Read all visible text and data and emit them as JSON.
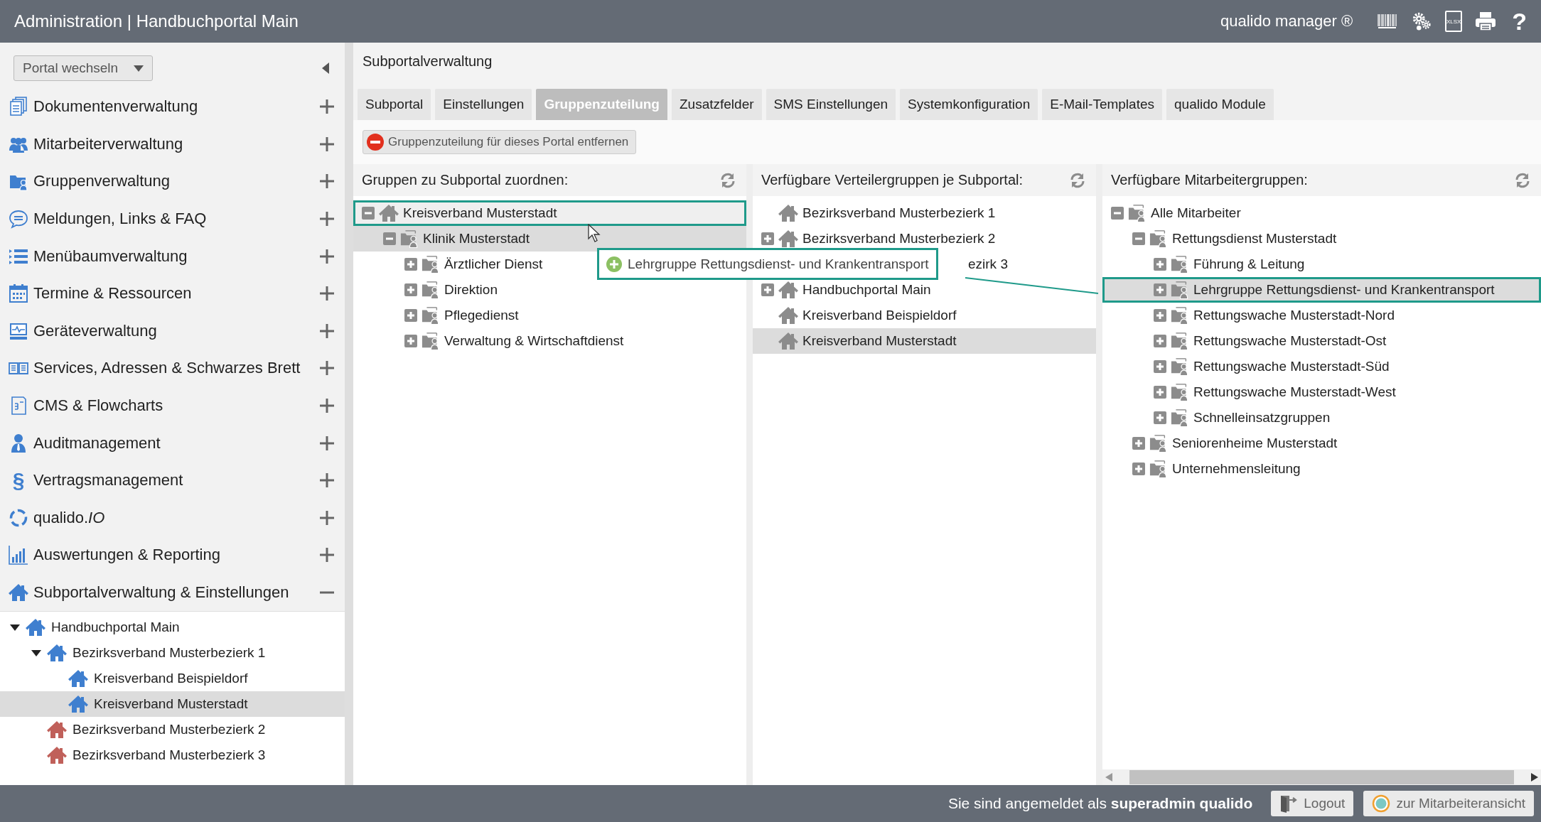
{
  "header": {
    "title": "Administration | Handbuchportal Main",
    "brand": "qualido manager ®",
    "tools": [
      {
        "kind": "barcode"
      },
      {
        "kind": "gears"
      },
      {
        "kind": "xlsx",
        "label": "XLSX"
      },
      {
        "kind": "printer"
      },
      {
        "kind": "help",
        "label": "?"
      }
    ]
  },
  "sidebar": {
    "portal_switch": "Portal wechseln",
    "menu": [
      {
        "label": "Dokumentenverwaltung",
        "kind": "documents",
        "expanded": false
      },
      {
        "label": "Mitarbeiterverwaltung",
        "kind": "people",
        "expanded": false
      },
      {
        "label": "Gruppenverwaltung",
        "kind": "group-folder",
        "expanded": false
      },
      {
        "label": "Meldungen, Links & FAQ",
        "kind": "chat",
        "expanded": false
      },
      {
        "label": "Menübaumverwaltung",
        "kind": "list",
        "expanded": false
      },
      {
        "label": "Termine & Ressourcen",
        "kind": "calendar",
        "expanded": false
      },
      {
        "label": "Geräteverwaltung",
        "kind": "monitor",
        "expanded": false
      },
      {
        "label": "Services, Adressen & Schwarzes Brett",
        "kind": "book",
        "expanded": false
      },
      {
        "label": "CMS & Flowcharts",
        "kind": "flowchart",
        "expanded": false
      },
      {
        "label": "Auditmanagement",
        "kind": "person",
        "expanded": false
      },
      {
        "label": "Vertragsmanagement",
        "kind": "glyph",
        "glyph": "§",
        "expanded": false
      },
      {
        "label": "qualido.*IO*",
        "kind": "ring",
        "expanded": false
      },
      {
        "label": "Auswertungen & Reporting",
        "kind": "bars",
        "expanded": false
      },
      {
        "label": "Subportalverwaltung & Einstellungen",
        "kind": "house",
        "expanded": true,
        "children": [
          {
            "label": "Handbuchportal Main",
            "color": "#3f7fcf",
            "expanded": true,
            "selected": false,
            "children": [
              {
                "label": "Bezirksverband Musterbezierk 1",
                "color": "#3f7fcf",
                "expanded": true,
                "selected": false,
                "children": [
                  {
                    "label": "Kreisverband Beispieldorf",
                    "color": "#3f7fcf",
                    "selected": false
                  },
                  {
                    "label": "Kreisverband Musterstadt",
                    "color": "#3f7fcf",
                    "selected": true
                  }
                ]
              },
              {
                "label": "Bezirksverband Musterbezierk 2",
                "color": "#c0605a",
                "selected": false
              },
              {
                "label": "Bezirksverband Musterbezierk 3",
                "color": "#c0605a",
                "selected": false
              }
            ]
          }
        ]
      }
    ]
  },
  "main": {
    "title": "Subportalverwaltung",
    "tabs": [
      {
        "label": "Subportal",
        "selected": false
      },
      {
        "label": "Einstellungen",
        "selected": false
      },
      {
        "label": "Gruppenzuteilung",
        "selected": true
      },
      {
        "label": "Zusatzfelder",
        "selected": false
      },
      {
        "label": "SMS Einstellungen",
        "selected": false
      },
      {
        "label": "Systemkonfiguration",
        "selected": false
      },
      {
        "label": "E-Mail-Templates",
        "selected": false
      },
      {
        "label": "qualido Module",
        "selected": false
      }
    ],
    "remove_button": "Gruppenzuteilung für dieses Portal entfernen",
    "columns": [
      {
        "title": "Gruppen zu Subportal zuordnen:",
        "items": [
          {
            "label": "Kreisverband Musterstadt",
            "kind": "house",
            "expanded": true,
            "selected": false,
            "outlined": true,
            "children": [
              {
                "label": "Klinik Musterstadt",
                "kind": "group",
                "expanded": true,
                "selected": true,
                "outlined": false,
                "children": [
                  {
                    "label": "Ärztlicher Dienst",
                    "kind": "group",
                    "expanded": false,
                    "selected": false,
                    "outlined": false
                  },
                  {
                    "label": "Direktion",
                    "kind": "group",
                    "expanded": false,
                    "selected": false,
                    "outlined": false
                  },
                  {
                    "label": "Pflegedienst",
                    "kind": "group",
                    "expanded": false,
                    "selected": false,
                    "outlined": false
                  },
                  {
                    "label": "Verwaltung & Wirtschaftdienst",
                    "kind": "group",
                    "expanded": false,
                    "selected": false,
                    "outlined": false
                  }
                ]
              }
            ]
          }
        ]
      },
      {
        "title": "Verfügbare Verteilergruppen je Subportal:",
        "items": [
          {
            "label": "Bezirksverband Musterbezierk 1",
            "kind": "house",
            "selected": false,
            "outlined": false
          },
          {
            "label": "Bezirksverband Musterbezierk 2",
            "kind": "house",
            "expanded": false,
            "selected": false,
            "outlined": false
          },
          {
            "label": "ezirk 3",
            "kind": "covered",
            "selected": false,
            "outlined": false
          },
          {
            "label": "Handbuchportal Main",
            "kind": "house",
            "expanded": false,
            "selected": false,
            "outlined": false
          },
          {
            "label": "Kreisverband Beispieldorf",
            "kind": "house",
            "selected": false,
            "outlined": false
          },
          {
            "label": "Kreisverband Musterstadt",
            "kind": "house",
            "selected": true,
            "outlined": false
          }
        ]
      },
      {
        "title": "Verfügbare Mitarbeitergruppen:",
        "items": [
          {
            "label": "Alle Mitarbeiter",
            "kind": "group",
            "expanded": true,
            "selected": false,
            "outlined": false,
            "children": [
              {
                "label": "Rettungsdienst Musterstadt",
                "kind": "group",
                "expanded": true,
                "selected": false,
                "outlined": false,
                "children": [
                  {
                    "label": "Führung & Leitung",
                    "kind": "group",
                    "expanded": false,
                    "selected": false,
                    "outlined": false
                  },
                  {
                    "label": "Lehrgruppe Rettungsdienst- und Krankentransport",
                    "kind": "group",
                    "expanded": false,
                    "selected": true,
                    "outlined": true
                  },
                  {
                    "label": "Rettungswache Musterstadt-Nord",
                    "kind": "group",
                    "expanded": false,
                    "selected": false,
                    "outlined": false
                  },
                  {
                    "label": "Rettungswache Musterstadt-Ost",
                    "kind": "group",
                    "expanded": false,
                    "selected": false,
                    "outlined": false
                  },
                  {
                    "label": "Rettungswache Musterstadt-Süd",
                    "kind": "group",
                    "expanded": false,
                    "selected": false,
                    "outlined": false
                  },
                  {
                    "label": "Rettungswache Musterstadt-West",
                    "kind": "group",
                    "expanded": false,
                    "selected": false,
                    "outlined": false
                  },
                  {
                    "label": "Schnelleinsatzgruppen",
                    "kind": "group",
                    "expanded": false,
                    "selected": false,
                    "outlined": false
                  }
                ]
              },
              {
                "label": "Seniorenheime Musterstadt",
                "kind": "group",
                "expanded": false,
                "selected": false,
                "outlined": false
              },
              {
                "label": "Unternehmensleitung",
                "kind": "group",
                "expanded": false,
                "selected": false,
                "outlined": false
              }
            ]
          }
        ]
      }
    ],
    "drag_item": {
      "label": "Lehrgruppe Rettungsdienst- und Krankentransport"
    }
  },
  "footer": {
    "login_text": "Sie sind angemeldet als **superadmin qualido**",
    "buttons": [
      {
        "label": "Logout",
        "kind": "door"
      },
      {
        "label": "zur Mitarbeiteransicht",
        "kind": "ring-dot"
      }
    ]
  }
}
